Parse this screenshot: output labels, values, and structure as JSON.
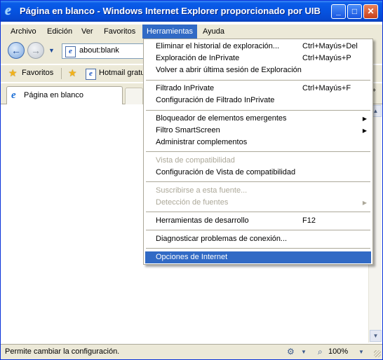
{
  "window": {
    "title": "Página en blanco - Windows Internet Explorer proporcionado por UIB",
    "controls": {
      "minimize": "_",
      "maximize": "□",
      "close": "✕"
    }
  },
  "menubar": {
    "items": [
      "Archivo",
      "Edición",
      "Ver",
      "Favoritos",
      "Herramientas",
      "Ayuda"
    ]
  },
  "address": {
    "value": "about:blank"
  },
  "favorites": {
    "label": "Favoritos",
    "link": "Hotmail gratu"
  },
  "tab": {
    "label": "Página en blanco"
  },
  "tools_menu": {
    "items": [
      {
        "label": "Eliminar el historial de exploración...",
        "shortcut": "Ctrl+Mayús+Del"
      },
      {
        "label": "Exploración de InPrivate",
        "shortcut": "Ctrl+Mayús+P"
      },
      {
        "label": "Volver a abrir última sesión de Exploración",
        "shortcut": ""
      },
      {
        "label": "Filtrado InPrivate",
        "shortcut": "Ctrl+Mayús+F"
      },
      {
        "label": "Configuración de Filtrado InPrivate",
        "shortcut": ""
      },
      {
        "label": "Bloqueador de elementos emergentes",
        "shortcut": ""
      },
      {
        "label": "Filtro SmartScreen",
        "shortcut": ""
      },
      {
        "label": "Administrar complementos",
        "shortcut": ""
      },
      {
        "label": "Vista de compatibilidad",
        "shortcut": ""
      },
      {
        "label": "Configuración de Vista de compatibilidad",
        "shortcut": ""
      },
      {
        "label": "Suscribirse a esta fuente...",
        "shortcut": ""
      },
      {
        "label": "Detección de fuentes",
        "shortcut": ""
      },
      {
        "label": "Herramientas de desarrollo",
        "shortcut": "F12"
      },
      {
        "label": "Diagnosticar problemas de conexión...",
        "shortcut": ""
      },
      {
        "label": "Opciones de Internet",
        "shortcut": ""
      }
    ]
  },
  "statusbar": {
    "text": "Permite cambiar la configuración.",
    "zoom": "100%"
  },
  "icons": {
    "app": "ie-logo-icon",
    "back": "back-arrow-icon",
    "forward": "forward-arrow-icon",
    "favorites": "star-icon",
    "add_favorite": "add-favorites-icon",
    "zoom": "magnifier-icon",
    "security": "security-zone-icon"
  },
  "colors": {
    "titlebar": "#0653e0",
    "menu_highlight": "#316ac5",
    "chrome": "#ece9d8"
  }
}
